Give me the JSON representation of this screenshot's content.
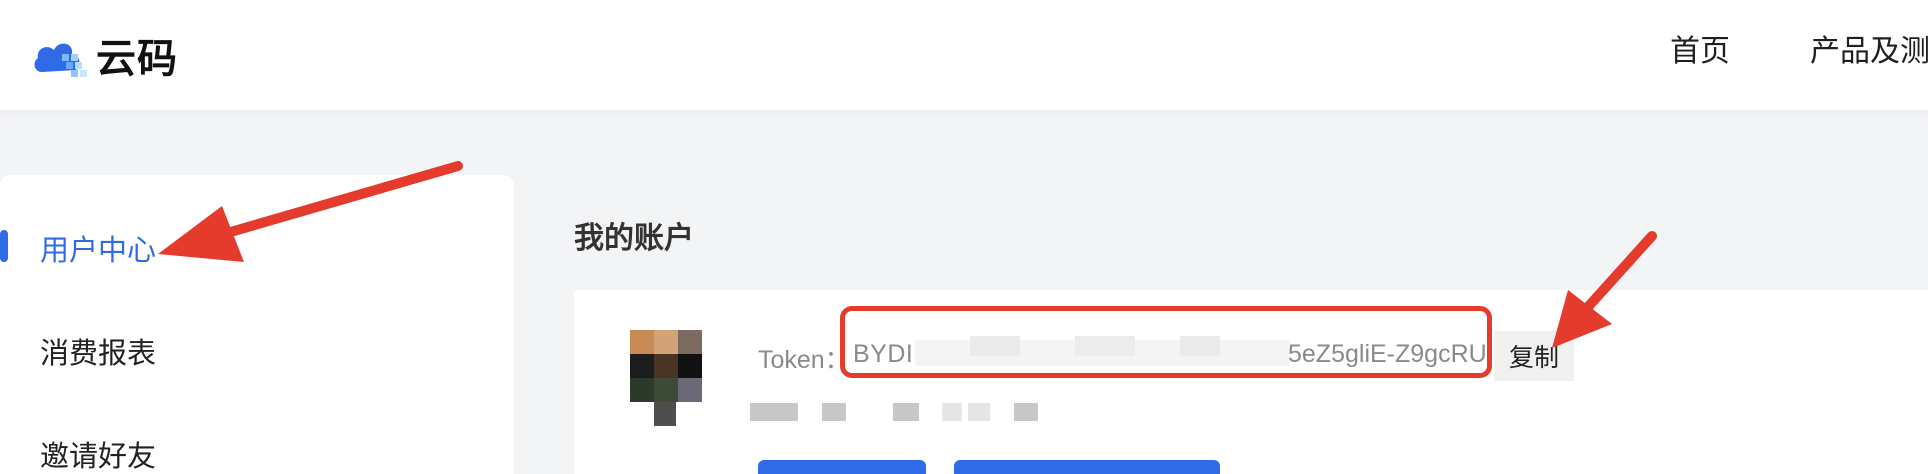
{
  "header": {
    "brand": "云码",
    "nav": [
      {
        "label": "首页"
      },
      {
        "label": "产品及测"
      }
    ]
  },
  "sidebar": {
    "items": [
      {
        "label": "用户中心",
        "active": true
      },
      {
        "label": "消费报表",
        "active": false
      },
      {
        "label": "邀请好友",
        "active": false
      }
    ]
  },
  "main": {
    "title": "我的账户",
    "token": {
      "label": "Token：",
      "value_start": "BYDI",
      "value_end": "5eZ5gliE-Z9gcRU",
      "copy_label": "复制"
    }
  },
  "colors": {
    "accent": "#2f6be6",
    "annotation": "#e43b2d"
  }
}
